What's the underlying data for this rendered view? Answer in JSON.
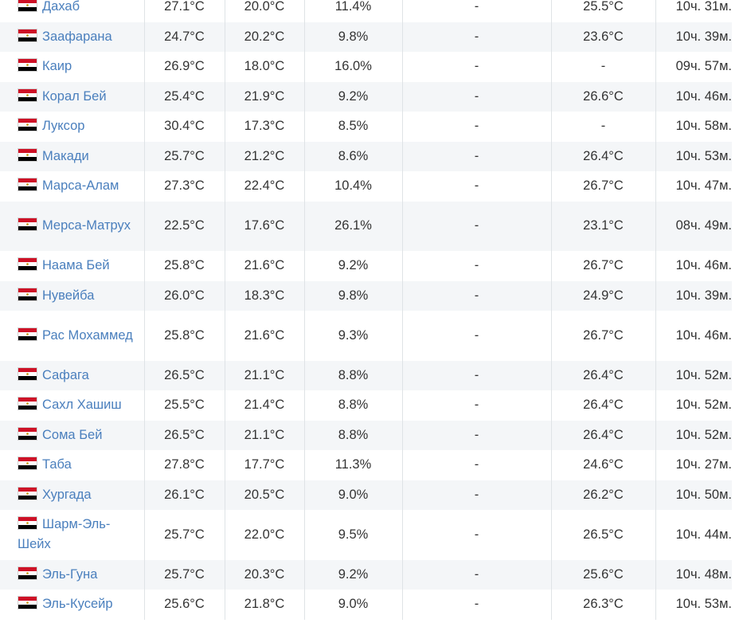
{
  "table": {
    "rows": [
      {
        "city": "Дахаб",
        "air_day": "27.1°C",
        "air_night": "20.0°C",
        "precip": "11.4%",
        "rain_days": "-",
        "water": "25.5°C",
        "daylight": "10ч. 31м."
      },
      {
        "city": "Заафарана",
        "air_day": "24.7°C",
        "air_night": "20.2°C",
        "precip": "9.8%",
        "rain_days": "-",
        "water": "23.6°C",
        "daylight": "10ч. 39м."
      },
      {
        "city": "Каир",
        "air_day": "26.9°C",
        "air_night": "18.0°C",
        "precip": "16.0%",
        "rain_days": "-",
        "water": "-",
        "daylight": "09ч. 57м."
      },
      {
        "city": "Корал Бей",
        "air_day": "25.4°C",
        "air_night": "21.9°C",
        "precip": "9.2%",
        "rain_days": "-",
        "water": "26.6°C",
        "daylight": "10ч. 46м."
      },
      {
        "city": "Луксор",
        "air_day": "30.4°C",
        "air_night": "17.3°C",
        "precip": "8.5%",
        "rain_days": "-",
        "water": "-",
        "daylight": "10ч. 58м."
      },
      {
        "city": "Макади",
        "air_day": "25.7°C",
        "air_night": "21.2°C",
        "precip": "8.6%",
        "rain_days": "-",
        "water": "26.4°C",
        "daylight": "10ч. 53м."
      },
      {
        "city": "Марса-Алам",
        "air_day": "27.3°C",
        "air_night": "22.4°C",
        "precip": "10.4%",
        "rain_days": "-",
        "water": "26.7°C",
        "daylight": "10ч. 47м."
      },
      {
        "city": "Мерса-Матрух",
        "air_day": "22.5°C",
        "air_night": "17.6°C",
        "precip": "26.1%",
        "rain_days": "-",
        "water": "23.1°C",
        "daylight": "08ч. 49м.",
        "wrap": true
      },
      {
        "city": "Наама Бей",
        "air_day": "25.8°C",
        "air_night": "21.6°C",
        "precip": "9.2%",
        "rain_days": "-",
        "water": "26.7°C",
        "daylight": "10ч. 46м."
      },
      {
        "city": "Нувейба",
        "air_day": "26.0°C",
        "air_night": "18.3°C",
        "precip": "9.8%",
        "rain_days": "-",
        "water": "24.9°C",
        "daylight": "10ч. 39м."
      },
      {
        "city": "Рас Мохаммед",
        "air_day": "25.8°C",
        "air_night": "21.6°C",
        "precip": "9.3%",
        "rain_days": "-",
        "water": "26.7°C",
        "daylight": "10ч. 46м.",
        "wrap": true
      },
      {
        "city": "Сафага",
        "air_day": "26.5°C",
        "air_night": "21.1°C",
        "precip": "8.8%",
        "rain_days": "-",
        "water": "26.4°C",
        "daylight": "10ч. 52м."
      },
      {
        "city": "Сахл Хашиш",
        "air_day": "25.5°C",
        "air_night": "21.4°C",
        "precip": "8.8%",
        "rain_days": "-",
        "water": "26.4°C",
        "daylight": "10ч. 52м."
      },
      {
        "city": "Сома Бей",
        "air_day": "26.5°C",
        "air_night": "21.1°C",
        "precip": "8.8%",
        "rain_days": "-",
        "water": "26.4°C",
        "daylight": "10ч. 52м."
      },
      {
        "city": "Таба",
        "air_day": "27.8°C",
        "air_night": "17.7°C",
        "precip": "11.3%",
        "rain_days": "-",
        "water": "24.6°C",
        "daylight": "10ч. 27м."
      },
      {
        "city": "Хургада",
        "air_day": "26.1°C",
        "air_night": "20.5°C",
        "precip": "9.0%",
        "rain_days": "-",
        "water": "26.2°C",
        "daylight": "10ч. 50м."
      },
      {
        "city": "Шарм-Эль-Шейх",
        "air_day": "25.7°C",
        "air_night": "22.0°C",
        "precip": "9.5%",
        "rain_days": "-",
        "water": "26.5°C",
        "daylight": "10ч. 44м.",
        "wrap": true
      },
      {
        "city": "Эль-Гуна",
        "air_day": "25.7°C",
        "air_night": "20.3°C",
        "precip": "9.2%",
        "rain_days": "-",
        "water": "25.6°C",
        "daylight": "10ч. 48м."
      },
      {
        "city": "Эль-Кусейр",
        "air_day": "25.6°C",
        "air_night": "21.8°C",
        "precip": "9.0%",
        "rain_days": "-",
        "water": "26.3°C",
        "daylight": "10ч. 53м."
      }
    ]
  },
  "flag": {
    "icon": "egypt-flag-icon",
    "colors": {
      "top": "#ce1126",
      "middle": "#ffffff",
      "bottom": "#000000",
      "emblem": "#c09300"
    }
  },
  "colors": {
    "link": "#4a7fbd",
    "text": "#333333",
    "stripe": "#f4f6f8",
    "divider": "#dfe3e6"
  }
}
